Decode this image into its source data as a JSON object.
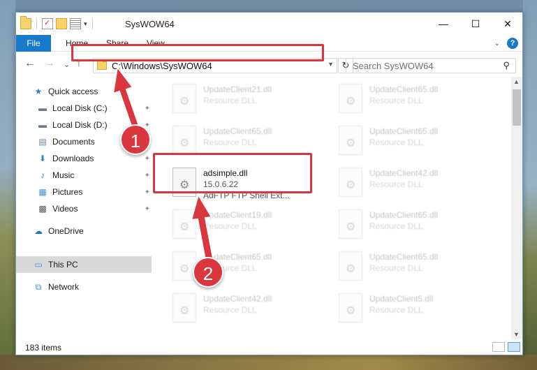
{
  "window": {
    "title": "SysWOW64",
    "minimize": "—",
    "maximize": "☐",
    "close": "✕"
  },
  "qat": {
    "icons": [
      "folder-icon",
      "properties-icon",
      "new-folder-icon",
      "customize-icon"
    ],
    "dropdown_glyph": "▾"
  },
  "ribbon": {
    "tabs": [
      "File",
      "Home",
      "Share",
      "View"
    ],
    "help_glyph": "?",
    "collapse_glyph": "⌄"
  },
  "nav": {
    "back": "←",
    "forward": "→",
    "recent": "⌄",
    "up": "↑",
    "address_path": "C:\\Windows\\SysWOW64",
    "refresh": "↻",
    "search_placeholder": "Search SysWOW64",
    "search_glyph": "⌕"
  },
  "sidebar": {
    "items": [
      {
        "label": "Quick access",
        "icon": "star-icon",
        "glyph": "★",
        "color": "#2f7fd0",
        "pinned": false
      },
      {
        "label": "Local Disk (C:)",
        "icon": "drive-icon",
        "glyph": "▬",
        "color": "#6b7c8c",
        "pinned": true
      },
      {
        "label": "Local Disk (D:)",
        "icon": "drive-icon",
        "glyph": "▬",
        "color": "#6b7c8c",
        "pinned": true
      },
      {
        "label": "Documents",
        "icon": "documents-icon",
        "glyph": "▤",
        "color": "#5f7fa6",
        "pinned": true
      },
      {
        "label": "Downloads",
        "icon": "download-icon",
        "glyph": "⬇",
        "color": "#2f7fd0",
        "pinned": true
      },
      {
        "label": "Music",
        "icon": "music-icon",
        "glyph": "♪",
        "color": "#2f7fd0",
        "pinned": true
      },
      {
        "label": "Pictures",
        "icon": "pictures-icon",
        "glyph": "▦",
        "color": "#3a8fd6",
        "pinned": true
      },
      {
        "label": "Videos",
        "icon": "videos-icon",
        "glyph": "▩",
        "color": "#555555",
        "pinned": true
      },
      {
        "label": "OneDrive",
        "icon": "cloud-icon",
        "glyph": "☁",
        "color": "#1f6fcf",
        "pinned": false
      },
      {
        "label": "This PC",
        "icon": "computer-icon",
        "glyph": "▭",
        "color": "#3a8fd6",
        "pinned": false,
        "selected": true
      },
      {
        "label": "Network",
        "icon": "network-icon",
        "glyph": "⧉",
        "color": "#3a8fd6",
        "pinned": false
      }
    ],
    "pin_glyph": "📌"
  },
  "files": {
    "left": [
      {
        "name": "UpdateClient21.dll",
        "type": "Resource DLL"
      },
      {
        "name": "UpdateClient65.dll",
        "type": "Resource DLL"
      },
      {
        "name": "UpdateClient19.dll",
        "type": "Resource DLL"
      },
      {
        "name": "UpdateClient65.dll",
        "type": "Resource DLL"
      },
      {
        "name": "UpdateClient42.dll",
        "type": "Resource DLL"
      }
    ],
    "highlighted": {
      "name": "adsimple.dll",
      "version": "15.0.6.22",
      "description": "AdFTP FTP Shell Ext..."
    },
    "right": [
      {
        "name": "UpdateClient65.dll",
        "type": "Resource DLL"
      },
      {
        "name": "UpdateClient65.dll",
        "type": "Resource DLL"
      },
      {
        "name": "UpdateClient42.dll",
        "type": "Resource DLL"
      },
      {
        "name": "UpdateClient65.dll",
        "type": "Resource DLL"
      },
      {
        "name": "UpdateClient65.dll",
        "type": "Resource DLL"
      },
      {
        "name": "UpdateClient5.dll",
        "type": "Resource DLL"
      }
    ]
  },
  "status": {
    "item_count": "183 items"
  },
  "annotations": {
    "step1": "1",
    "step2": "2",
    "color": "#d9363e"
  }
}
